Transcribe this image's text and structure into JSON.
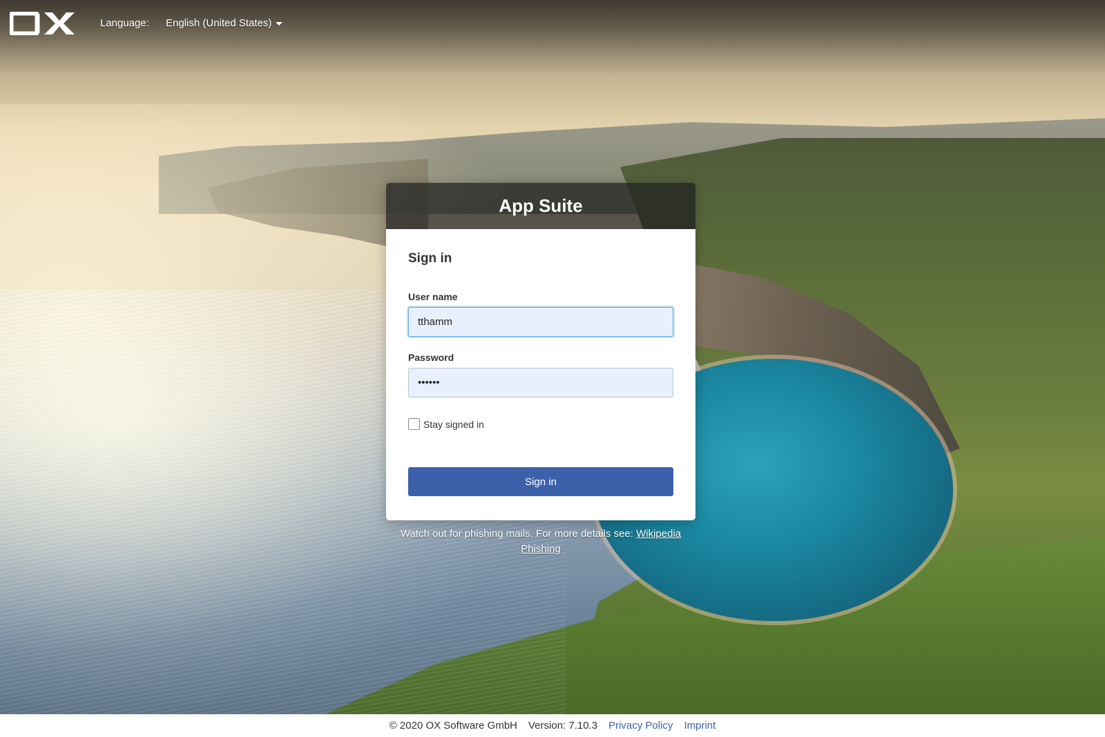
{
  "topbar": {
    "logo_text": "OX",
    "language_label": "Language:",
    "language_value": "English (United States)"
  },
  "login": {
    "product_name": "App Suite",
    "title": "Sign in",
    "username_label": "User name",
    "username_value": "tthamm",
    "password_label": "Password",
    "password_value": "••••••",
    "stay_signed_in_label": "Stay signed in",
    "stay_signed_in_checked": false,
    "submit_label": "Sign in"
  },
  "notice": {
    "text": "Watch out for phishing mails. For more details see: ",
    "link_text": "Wikipedia Phishing"
  },
  "footer": {
    "copyright": "© 2020 OX Software GmbH",
    "version": "Version: 7.10.3",
    "privacy_link": "Privacy Policy",
    "imprint_link": "Imprint"
  },
  "colors": {
    "primary_button": "#3c61aa",
    "input_background": "#e8f0fe",
    "header_background": "#1e1e1e"
  }
}
